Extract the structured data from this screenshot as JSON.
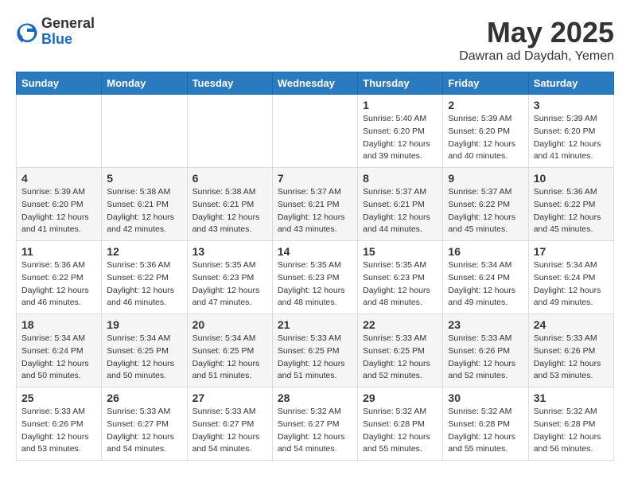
{
  "header": {
    "logo_general": "General",
    "logo_blue": "Blue",
    "month": "May 2025",
    "location": "Dawran ad Daydah, Yemen"
  },
  "days_of_week": [
    "Sunday",
    "Monday",
    "Tuesday",
    "Wednesday",
    "Thursday",
    "Friday",
    "Saturday"
  ],
  "weeks": [
    [
      {
        "day": "",
        "info": ""
      },
      {
        "day": "",
        "info": ""
      },
      {
        "day": "",
        "info": ""
      },
      {
        "day": "",
        "info": ""
      },
      {
        "day": "1",
        "info": "Sunrise: 5:40 AM\nSunset: 6:20 PM\nDaylight: 12 hours\nand 39 minutes."
      },
      {
        "day": "2",
        "info": "Sunrise: 5:39 AM\nSunset: 6:20 PM\nDaylight: 12 hours\nand 40 minutes."
      },
      {
        "day": "3",
        "info": "Sunrise: 5:39 AM\nSunset: 6:20 PM\nDaylight: 12 hours\nand 41 minutes."
      }
    ],
    [
      {
        "day": "4",
        "info": "Sunrise: 5:39 AM\nSunset: 6:20 PM\nDaylight: 12 hours\nand 41 minutes."
      },
      {
        "day": "5",
        "info": "Sunrise: 5:38 AM\nSunset: 6:21 PM\nDaylight: 12 hours\nand 42 minutes."
      },
      {
        "day": "6",
        "info": "Sunrise: 5:38 AM\nSunset: 6:21 PM\nDaylight: 12 hours\nand 43 minutes."
      },
      {
        "day": "7",
        "info": "Sunrise: 5:37 AM\nSunset: 6:21 PM\nDaylight: 12 hours\nand 43 minutes."
      },
      {
        "day": "8",
        "info": "Sunrise: 5:37 AM\nSunset: 6:21 PM\nDaylight: 12 hours\nand 44 minutes."
      },
      {
        "day": "9",
        "info": "Sunrise: 5:37 AM\nSunset: 6:22 PM\nDaylight: 12 hours\nand 45 minutes."
      },
      {
        "day": "10",
        "info": "Sunrise: 5:36 AM\nSunset: 6:22 PM\nDaylight: 12 hours\nand 45 minutes."
      }
    ],
    [
      {
        "day": "11",
        "info": "Sunrise: 5:36 AM\nSunset: 6:22 PM\nDaylight: 12 hours\nand 46 minutes."
      },
      {
        "day": "12",
        "info": "Sunrise: 5:36 AM\nSunset: 6:22 PM\nDaylight: 12 hours\nand 46 minutes."
      },
      {
        "day": "13",
        "info": "Sunrise: 5:35 AM\nSunset: 6:23 PM\nDaylight: 12 hours\nand 47 minutes."
      },
      {
        "day": "14",
        "info": "Sunrise: 5:35 AM\nSunset: 6:23 PM\nDaylight: 12 hours\nand 48 minutes."
      },
      {
        "day": "15",
        "info": "Sunrise: 5:35 AM\nSunset: 6:23 PM\nDaylight: 12 hours\nand 48 minutes."
      },
      {
        "day": "16",
        "info": "Sunrise: 5:34 AM\nSunset: 6:24 PM\nDaylight: 12 hours\nand 49 minutes."
      },
      {
        "day": "17",
        "info": "Sunrise: 5:34 AM\nSunset: 6:24 PM\nDaylight: 12 hours\nand 49 minutes."
      }
    ],
    [
      {
        "day": "18",
        "info": "Sunrise: 5:34 AM\nSunset: 6:24 PM\nDaylight: 12 hours\nand 50 minutes."
      },
      {
        "day": "19",
        "info": "Sunrise: 5:34 AM\nSunset: 6:25 PM\nDaylight: 12 hours\nand 50 minutes."
      },
      {
        "day": "20",
        "info": "Sunrise: 5:34 AM\nSunset: 6:25 PM\nDaylight: 12 hours\nand 51 minutes."
      },
      {
        "day": "21",
        "info": "Sunrise: 5:33 AM\nSunset: 6:25 PM\nDaylight: 12 hours\nand 51 minutes."
      },
      {
        "day": "22",
        "info": "Sunrise: 5:33 AM\nSunset: 6:25 PM\nDaylight: 12 hours\nand 52 minutes."
      },
      {
        "day": "23",
        "info": "Sunrise: 5:33 AM\nSunset: 6:26 PM\nDaylight: 12 hours\nand 52 minutes."
      },
      {
        "day": "24",
        "info": "Sunrise: 5:33 AM\nSunset: 6:26 PM\nDaylight: 12 hours\nand 53 minutes."
      }
    ],
    [
      {
        "day": "25",
        "info": "Sunrise: 5:33 AM\nSunset: 6:26 PM\nDaylight: 12 hours\nand 53 minutes."
      },
      {
        "day": "26",
        "info": "Sunrise: 5:33 AM\nSunset: 6:27 PM\nDaylight: 12 hours\nand 54 minutes."
      },
      {
        "day": "27",
        "info": "Sunrise: 5:33 AM\nSunset: 6:27 PM\nDaylight: 12 hours\nand 54 minutes."
      },
      {
        "day": "28",
        "info": "Sunrise: 5:32 AM\nSunset: 6:27 PM\nDaylight: 12 hours\nand 54 minutes."
      },
      {
        "day": "29",
        "info": "Sunrise: 5:32 AM\nSunset: 6:28 PM\nDaylight: 12 hours\nand 55 minutes."
      },
      {
        "day": "30",
        "info": "Sunrise: 5:32 AM\nSunset: 6:28 PM\nDaylight: 12 hours\nand 55 minutes."
      },
      {
        "day": "31",
        "info": "Sunrise: 5:32 AM\nSunset: 6:28 PM\nDaylight: 12 hours\nand 56 minutes."
      }
    ]
  ]
}
